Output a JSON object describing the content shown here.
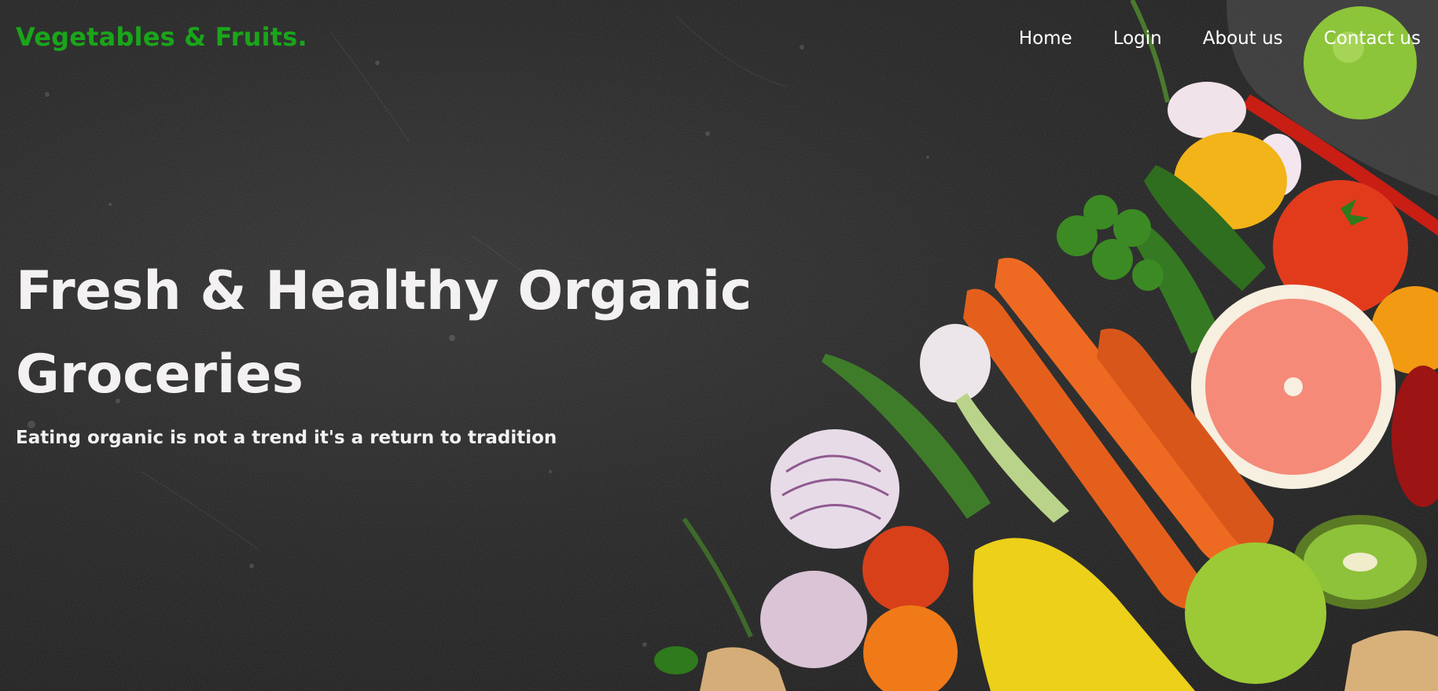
{
  "brand": {
    "logo_text": "Vegetables & Fruits.",
    "accent_color": "#1aa51a"
  },
  "nav": {
    "items": [
      {
        "label": "Home"
      },
      {
        "label": "Login"
      },
      {
        "label": "About us"
      },
      {
        "label": "Contact us"
      }
    ]
  },
  "hero": {
    "headline": "Fresh & Healthy Organic Groceries",
    "tagline": "Eating organic is not a trend it's a return to tradition",
    "background_image": "dark stone surface with fresh vegetables and fruits"
  }
}
